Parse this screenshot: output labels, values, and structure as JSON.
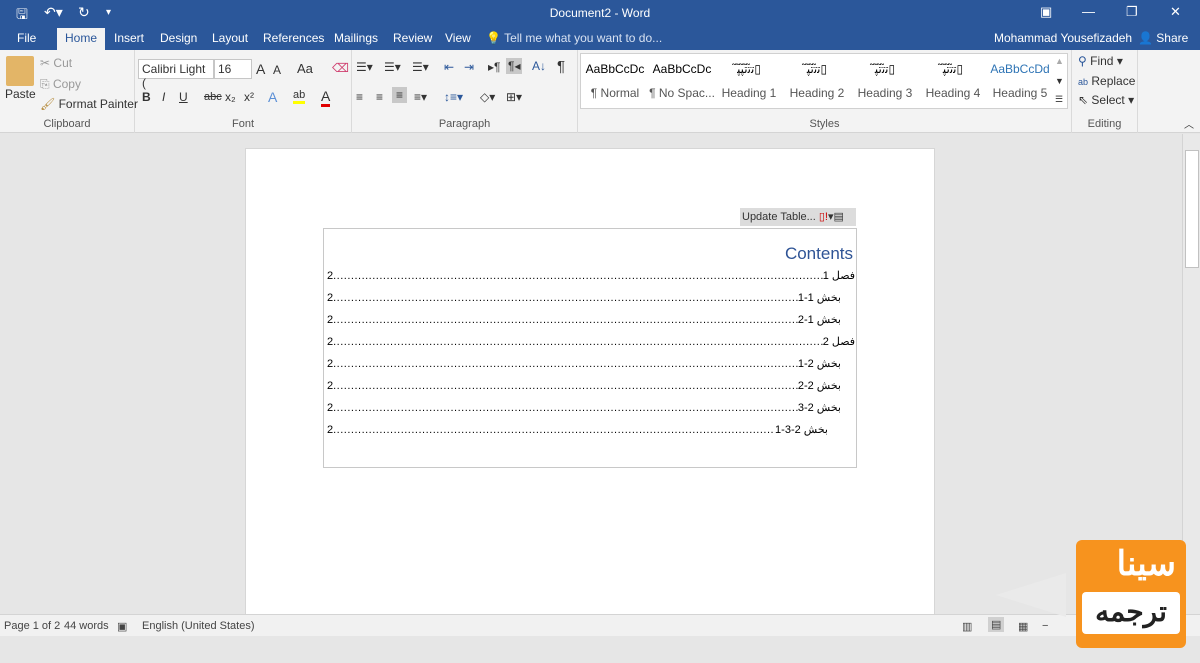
{
  "window": {
    "title": "Document2 - Word"
  },
  "quick_access": {
    "save": "save-icon",
    "undo": "undo-icon",
    "redo": "redo-icon",
    "customize": "customize-icon"
  },
  "tabs": [
    "File",
    "Home",
    "Insert",
    "Design",
    "Layout",
    "References",
    "Mailings",
    "Review",
    "View"
  ],
  "tell_me": "Tell me what you want to do...",
  "user": "Mohammad Yousefizadeh",
  "share": "Share",
  "clipboard": {
    "paste": "Paste",
    "cut": "Cut",
    "copy": "Copy",
    "format_painter": "Format Painter",
    "label": "Clipboard"
  },
  "font": {
    "name": "Calibri Light (",
    "size": "16",
    "label": "Font",
    "change_case": "Aa",
    "bold": "B",
    "italic": "I",
    "underline": "U",
    "strike": "abc",
    "sub": "x₂",
    "sup": "x²",
    "effects": "A",
    "highlight": "ab",
    "color": "A",
    "grow": "A",
    "shrink": "A",
    "highlight_color": "#ffff00",
    "font_color": "#e00000"
  },
  "paragraph": {
    "label": "Paragraph",
    "pilcrow": "¶"
  },
  "styles": {
    "label": "Styles",
    "items": [
      {
        "preview": "AaBbCcDc",
        "name": "¶ Normal"
      },
      {
        "preview": "AaBbCcDc",
        "name": "¶ No Spac..."
      },
      {
        "preview": "ﺗ̃ﺗ̃ﺗ̃ﭙ̃ﭙ̃▯",
        "name": "Heading 1"
      },
      {
        "preview": "ﺗ̃ﺗ̃ﺗ̃ﭙ̃▯",
        "name": "Heading 2"
      },
      {
        "preview": "ﺗ̃ﺗ̃ﺗ̃ﭙ̃▯",
        "name": "Heading 3"
      },
      {
        "preview": "ﺗ̃ﺗ̃ﺗ̃ﭙ̃▯",
        "name": "Heading 4"
      },
      {
        "preview": "AaBbCcDd",
        "name": "Heading 5"
      }
    ]
  },
  "editing": {
    "label": "Editing",
    "find": "Find",
    "replace": "Replace",
    "select": "Select"
  },
  "toc_toolbar": {
    "update": "Update Table..."
  },
  "toc": {
    "title": "Contents",
    "entries": [
      {
        "label": "فصل 1",
        "page": "2",
        "level": 1
      },
      {
        "label": "بخش 1-1",
        "page": "2",
        "level": 2
      },
      {
        "label": "بخش 1-2",
        "page": "2",
        "level": 2
      },
      {
        "label": "فصل 2",
        "page": "2",
        "level": 1
      },
      {
        "label": "بخش 2-1",
        "page": "2",
        "level": 2
      },
      {
        "label": "بخش 2-2",
        "page": "2",
        "level": 2
      },
      {
        "label": "بخش 2-3",
        "page": "2",
        "level": 2
      },
      {
        "label": "بخش 2-3-1",
        "page": "2",
        "level": 3
      }
    ]
  },
  "status": {
    "page": "Page 1 of 2",
    "words": "44 words",
    "language": "English (United States)"
  },
  "watermark": {
    "line1": "سینا",
    "line2": "ترجمه"
  }
}
